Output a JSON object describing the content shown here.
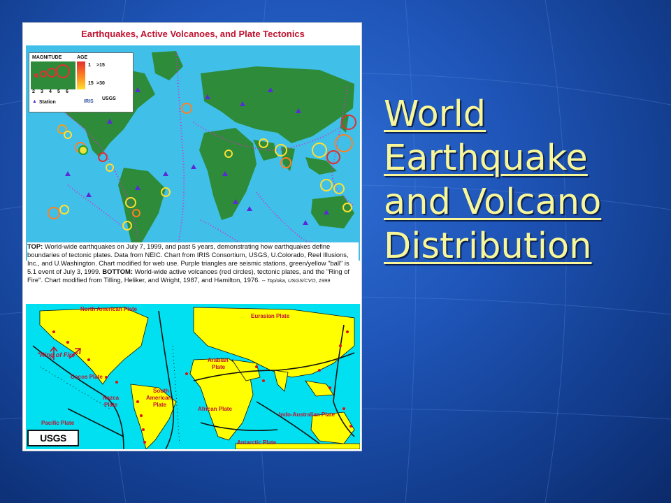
{
  "slide": {
    "title_link": {
      "lines": [
        "World",
        "Earthquake",
        "and Volcano",
        "Distribution"
      ]
    },
    "colors": {
      "background": "#1f55b8",
      "title_text": "#f7f79a",
      "map_ocean_top": "#40c0e8",
      "map_land_top": "#2e8b3a",
      "map_ocean_bottom": "#00e0f0",
      "map_land_bottom": "#ffff00"
    }
  },
  "figure": {
    "title": "Earthquakes, Active Volcanoes, and Plate Tectonics",
    "legend": {
      "magnitude_header": "MAGNITUDE",
      "age_header": "AGE",
      "magnitudes": [
        "2",
        "3",
        "4",
        "5",
        "6"
      ],
      "ages": [
        "1",
        ">15",
        "15",
        ">30"
      ],
      "station_label": "Station",
      "logos": [
        "IRIS",
        "USGS"
      ]
    },
    "caption": {
      "top_label": "TOP:",
      "top_text": "World-wide earthquakes on July 7, 1999, and past 5 years, demonstrating how earthquakes define boundaries of tectonic plates. Data from NEIC. Chart from IRIS Consortium, USGS, U.Colorado, Reel Illusions, Inc., and U.Washington. Chart modified for web use. Purple triangles are seismic stations, green/yellow \"ball\" is 5.1 event of July 3, 1999.",
      "bottom_label": "BOTTOM:",
      "bottom_text": "World-wide active volcanoes (red circles), tectonic plates, and the \"Ring of Fire\". Chart modified from Tilling, Heliker, and Wright, 1987, and Hamilton, 1976.",
      "credit": "-- Topinka, USGS/CVO, 1999"
    },
    "plates": {
      "north_american": "North American Plate",
      "eurasian": "Eurasian Plate",
      "ring_of_fire": "\"Ring of Fire\"",
      "arabian_1": "Arabian",
      "arabian_2": "Plate",
      "cocos": "Cocos Plate",
      "south_american_1": "South",
      "south_american_2": "American",
      "south_american_3": "Plate",
      "nazca_1": "Nazca",
      "nazca_2": "Plate",
      "african": "African Plate",
      "indo_australian": "Indo-Australian Plate",
      "pacific": "Pacific Plate",
      "antarctic": "Antarctic Plate"
    },
    "usgs_logo": "USGS"
  }
}
